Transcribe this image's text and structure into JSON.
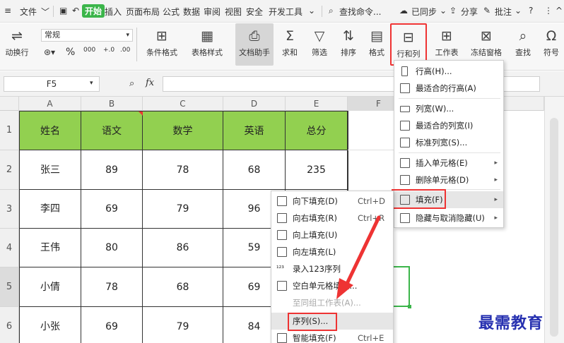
{
  "menubar": {
    "file": "文件",
    "start": "开始",
    "insert": "插入",
    "page_layout": "页面布局",
    "formula": "公式",
    "data": "数据",
    "review": "审阅",
    "view": "视图",
    "security": "安全",
    "dev_tools": "开发工具",
    "search": "查找命令...",
    "sync": "已同步",
    "share": "分享",
    "comment": "批注",
    "help": "?"
  },
  "ribbon": {
    "wrap": "动换行",
    "format_value": "常规",
    "percent": "%",
    "thousands": "000",
    "inc_dec": "+.0",
    "dec_dec": ".00",
    "cond_format": "条件格式",
    "table_style": "表格样式",
    "doc_helper": "文档助手",
    "sum": "求和",
    "filter": "筛选",
    "sort": "排序",
    "format": "格式",
    "row_col": "行和列",
    "worksheet": "工作表",
    "freeze": "冻结窗格",
    "find": "查找",
    "symbol": "符号"
  },
  "formula_bar": {
    "name_box": "F5",
    "fx": "fx"
  },
  "grid": {
    "columns": [
      "A",
      "B",
      "C",
      "D",
      "E",
      "F"
    ],
    "rows": [
      "1",
      "2",
      "3",
      "4",
      "5",
      "6"
    ],
    "header": [
      "姓名",
      "语文",
      "数学",
      "英语",
      "总分"
    ],
    "data": [
      [
        "张三",
        "89",
        "78",
        "68",
        "235"
      ],
      [
        "李四",
        "69",
        "79",
        "96",
        ""
      ],
      [
        "王伟",
        "80",
        "86",
        "59",
        ""
      ],
      [
        "小倩",
        "78",
        "68",
        "69",
        ""
      ],
      [
        "小张",
        "69",
        "79",
        "84",
        ""
      ]
    ]
  },
  "rowcol_menu": {
    "row_height": "行高(H)...",
    "best_row_height": "最适合的行高(A)",
    "col_width": "列宽(W)...",
    "best_col_width": "最适合的列宽(I)",
    "std_col_width": "标准列宽(S)...",
    "insert_cells": "插入单元格(E)",
    "delete_cells": "删除单元格(D)",
    "fill": "填充(F)",
    "hide_unhide": "隐藏与取消隐藏(U)"
  },
  "fill_menu": {
    "down": "向下填充(D)",
    "down_sc": "Ctrl+D",
    "right": "向右填充(R)",
    "right_sc": "Ctrl+R",
    "up": "向上填充(U)",
    "left": "向左填充(L)",
    "enter_seq": "录入123序列",
    "blank_fill": "空白单元格填充...",
    "same_group": "至同组工作表(A)...",
    "series": "序列(S)...",
    "smart_fill": "智能填充(F)",
    "smart_sc": "Ctrl+E"
  },
  "watermark": "最需教育",
  "colors": {
    "accent": "#3bb54a",
    "header_fill": "#92d050",
    "highlight_red": "#e33333",
    "menu_hover": "#e6e6e6"
  }
}
